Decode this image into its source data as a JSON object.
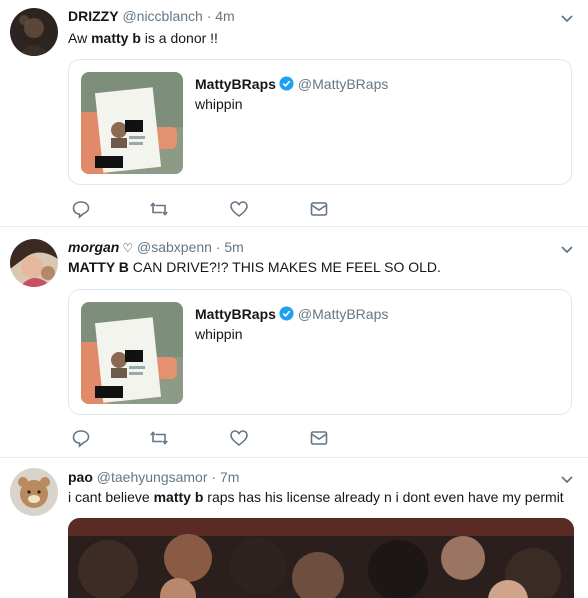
{
  "tweets": [
    {
      "name": "DRIZZY",
      "handle": "@niccblanch",
      "time": "· 4m",
      "text_parts": [
        "Aw ",
        "matty b",
        " is a donor !!"
      ],
      "quote": {
        "name": "MattyBRaps",
        "handle": "@MattyBRaps",
        "text": "whippin"
      }
    },
    {
      "name": "morgan",
      "handle": "@sabxpenn",
      "time": "· 5m",
      "text_parts": [
        "MATTY B",
        " CAN DRIVE?!? THIS MAKES ME FEEL SO OLD."
      ],
      "quote": {
        "name": "MattyBRaps",
        "handle": "@MattyBRaps",
        "text": "whippin"
      }
    },
    {
      "name": "pao",
      "handle": "@taehyungsamor",
      "time": "· 7m",
      "text_parts": [
        "i cant believe ",
        "matty b",
        " raps has his license already n i dont even have my permit"
      ]
    }
  ],
  "icons": {
    "reply": "reply-icon",
    "retweet": "retweet-icon",
    "like": "heart-icon",
    "dm": "envelope-icon",
    "menu": "chevron-down-icon",
    "verified": "verified-badge-icon"
  },
  "colors": {
    "text": "#14171a",
    "muted": "#657786",
    "border": "#e6ecf0",
    "verified": "#1da1f2"
  }
}
